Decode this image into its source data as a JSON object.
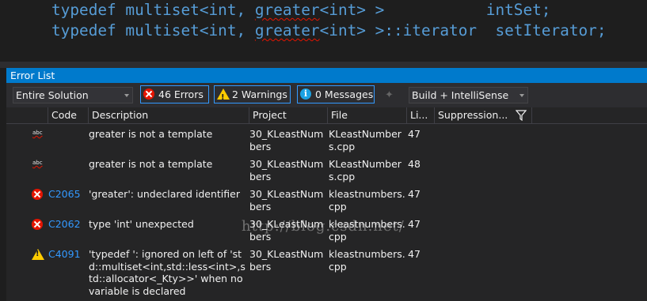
{
  "editor": {
    "line1": {
      "typedef": "typedef",
      "multiset": "multiset<int,",
      "greater": "greater",
      "rest": "<int> >",
      "name": "intSet;"
    },
    "line2": {
      "typedef": "typedef",
      "multiset": "multiset<int,",
      "greater": "greater",
      "rest": "<int> >::iterator",
      "name": "setIterator;"
    }
  },
  "panel": {
    "title": "Error List",
    "scope_dropdown": "Entire Solution",
    "errors_button": "46 Errors",
    "warnings_button": "2 Warnings",
    "messages_button": "0 Messages",
    "source_dropdown": "Build + IntelliSense",
    "columns": {
      "code": "Code",
      "description": "Description",
      "project": "Project",
      "file": "File",
      "line": "Li...",
      "suppression": "Suppression..."
    },
    "rows": [
      {
        "type": "abc",
        "code": "",
        "description": "greater is not a template",
        "project": "30_KLeastNumbers",
        "file": "KLeastNumbers.cpp",
        "line": "47"
      },
      {
        "type": "abc",
        "code": "",
        "description": "greater is not a template",
        "project": "30_KLeastNumbers",
        "file": "KLeastNumbers.cpp",
        "line": "48"
      },
      {
        "type": "error",
        "code": "C2065",
        "description": "'greater': undeclared identifier",
        "project": "30_KLeastNumbers",
        "file": "kleastnumbers.cpp",
        "line": "47"
      },
      {
        "type": "error",
        "code": "C2062",
        "description": "type 'int' unexpected",
        "project": "30_KLeastNumbers",
        "file": "kleastnumbers.cpp",
        "line": "47"
      },
      {
        "type": "warning",
        "code": "C4091",
        "description": "'typedef ': ignored on left of 'std::multiset<int,std::less<int>,std::allocator<_Kty>>' when no variable is declared",
        "project": "30_KLeastNumbers",
        "file": "kleastnumbers.cpp",
        "line": "47"
      }
    ],
    "watermark": "http://blog.csdn.net/"
  },
  "colors": {
    "accent": "#007acc",
    "error": "#e51400",
    "warning": "#ffcc00",
    "link": "#3399ff"
  }
}
